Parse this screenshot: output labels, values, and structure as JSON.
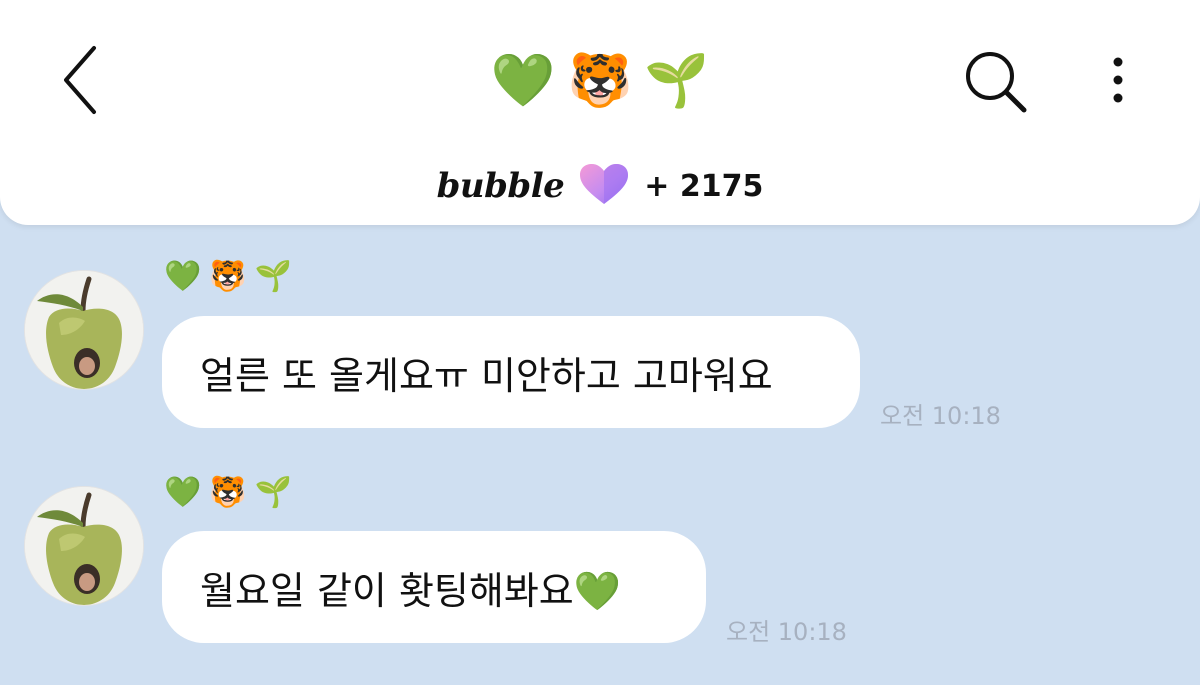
{
  "header": {
    "title_emojis": [
      "💚",
      "🐯",
      "🌱"
    ],
    "brand": "bubble",
    "brand_heart": "💗",
    "count": "+ 2175"
  },
  "messages": [
    {
      "sender_emojis": [
        "💚",
        "🐯",
        "🌱"
      ],
      "text": "얼른 또 올게요ㅠ 미안하고 고마워요",
      "time": "오전 10:18"
    },
    {
      "sender_emojis": [
        "💚",
        "🐯",
        "🌱"
      ],
      "text": "월요일 같이 홧팅해봐요💚",
      "time": "오전 10:18"
    }
  ],
  "icons": {
    "back": "back-arrow-icon",
    "search": "search-icon",
    "more": "more-vertical-icon"
  },
  "colors": {
    "chat_background": "#cfdff1",
    "header_background": "#ffffff",
    "bubble_background": "#ffffff",
    "timestamp": "#a7b1c0"
  }
}
